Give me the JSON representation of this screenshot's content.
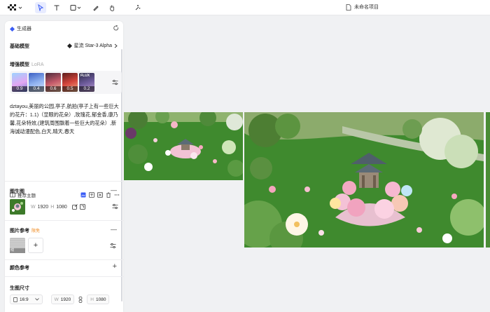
{
  "toolbar": {
    "tools": [
      {
        "name": "select",
        "active": true
      },
      {
        "name": "text"
      },
      {
        "name": "shape"
      },
      {
        "name": "pen"
      },
      {
        "name": "hand"
      },
      {
        "name": "magic"
      }
    ],
    "doc_title": "未命名项目"
  },
  "panel": {
    "header": "生成器",
    "base_model_label": "基础模型",
    "base_model_value": "星流 Star-3 Alpha",
    "lora_label": "增强模型",
    "lora_sub": "LoRA",
    "lora_weights": [
      "0.9",
      "0.4",
      "0.6",
      "0.5",
      "0.2"
    ],
    "lora_flux_text": "FLUX",
    "prompt": "dztayou,美丽的公园,亭子,航拍(亭子上有一些巨大的花卉：1.1)（显眼的花朵）,玫瑰花,郁金香,康乃馨,花朵特效,(建筑周围飘着一些巨大的花朵）,新海诚动漫配色,白天,晴天,春天",
    "recommend_label": "推荐主题",
    "bg_label": "图生图",
    "bg_width_label": "W",
    "bg_width": "1920",
    "bg_height_label": "H",
    "bg_height": "1080",
    "ref_label": "图片参考",
    "ref_tag": "限免",
    "ref_thumb_text": "线",
    "color_label": "颜色参考",
    "size_label": "生图尺寸",
    "aspect": "16:9",
    "size_w_label": "W",
    "size_w": "1920",
    "size_h_label": "H",
    "size_h": "1080"
  },
  "colors": {
    "accent": "#3a5cf5",
    "grass": "#3f8a2e",
    "tag_orange": "#f08a1f"
  }
}
